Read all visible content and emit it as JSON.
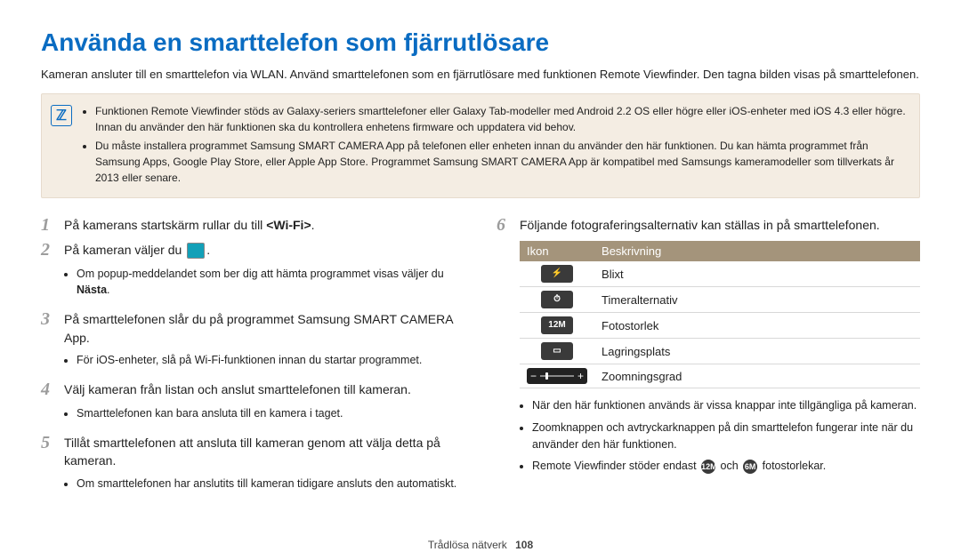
{
  "title": "Använda en smarttelefon som fjärrutlösare",
  "intro": "Kameran ansluter till en smarttelefon via WLAN. Använd smarttelefonen som en fjärrutlösare med funktionen Remote Viewfinder. Den tagna bilden visas på smarttelefonen.",
  "note_icon_label": "ℤ",
  "note": [
    "Funktionen Remote Viewfinder stöds av Galaxy-seriers smarttelefoner eller Galaxy Tab-modeller med Android 2.2 OS eller högre eller iOS-enheter med iOS 4.3 eller högre. Innan du använder den här funktionen ska du kontrollera enhetens firmware och uppdatera vid behov.",
    "Du måste installera programmet Samsung SMART CAMERA App på telefonen eller enheten innan du använder den här funktionen. Du kan hämta programmet från Samsung Apps, Google Play Store, eller Apple App Store. Programmet Samsung SMART CAMERA App är kompatibel med Samsungs kameramodeller som tillverkats år 2013 eller senare."
  ],
  "steps": {
    "1": {
      "pre": "På kamerans startskärm rullar du till ",
      "bold": "<Wi-Fi>",
      "post": "."
    },
    "2": {
      "pre": "På kameran väljer du ",
      "post": ".",
      "sub": "Om popup-meddelandet som ber dig att hämta programmet visas väljer du ",
      "sub_bold": "Nästa",
      "sub_post": "."
    },
    "3": {
      "text": "På smarttelefonen slår du på programmet Samsung SMART CAMERA App.",
      "sub": "För iOS-enheter, slå på Wi-Fi-funktionen innan du startar programmet."
    },
    "4": {
      "text": "Välj kameran från listan och anslut smarttelefonen till kameran.",
      "sub": "Smarttelefonen kan bara ansluta till en kamera i taget."
    },
    "5": {
      "text": "Tillåt smarttelefonen att ansluta till kameran genom att välja detta på kameran.",
      "sub": "Om smarttelefonen har anslutits till kameran tidigare ansluts den automatiskt."
    },
    "6": {
      "text": "Följande fotograferingsalternativ kan ställas in på smarttelefonen."
    }
  },
  "table": {
    "headers": {
      "icon": "Ikon",
      "desc": "Beskrivning"
    },
    "rows": [
      {
        "icon_name": "flash-icon",
        "icon_label": "⚡",
        "desc": "Blixt"
      },
      {
        "icon_name": "timer-icon",
        "icon_label": "⏱",
        "desc": "Timeralternativ"
      },
      {
        "icon_name": "size-icon",
        "icon_label": "12M",
        "desc": "Fotostorlek"
      },
      {
        "icon_name": "storage-icon",
        "icon_label": "▭",
        "desc": "Lagringsplats"
      },
      {
        "icon_name": "zoom-icon",
        "icon_label": "zoom",
        "desc": "Zoomningsgrad"
      }
    ]
  },
  "right_notes": [
    "När den här funktionen används är vissa knappar inte tillgängliga på kameran.",
    "Zoomknappen och avtryckarknappen på din smarttelefon fungerar inte när du använder den här funktionen."
  ],
  "right_note3_pre": "Remote Viewfinder stöder endast ",
  "right_note3_mid": " och ",
  "right_note3_post": " fotostorlekar.",
  "size_icon1": "12M",
  "size_icon2": "6M",
  "footer_section": "Trådlösa nätverk",
  "footer_page": "108"
}
